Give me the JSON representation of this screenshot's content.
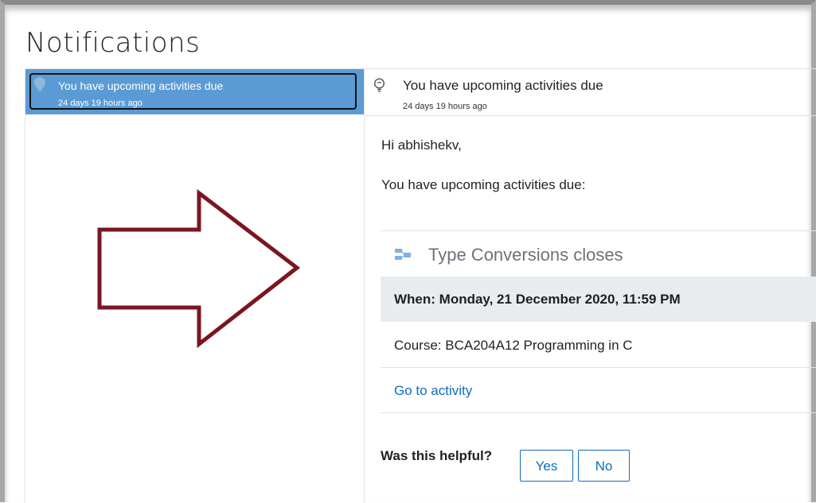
{
  "page": {
    "title": "Notifications"
  },
  "notification_list": {
    "items": [
      {
        "title": "You have upcoming activities due",
        "time": "24 days 19 hours ago",
        "selected": true
      }
    ]
  },
  "notification_detail": {
    "title": "You have upcoming activities due",
    "time": "24 days 19 hours ago",
    "greeting": "Hi abhishekv,",
    "intro": "You have upcoming activities due:",
    "event": {
      "name": "Type Conversions closes",
      "when": "When: Monday, 21 December 2020, 11:59 PM",
      "course": "Course: BCA204A12 Programming in C",
      "link_label": "Go to activity"
    },
    "feedback": {
      "question": "Was this helpful?",
      "yes_label": "Yes",
      "no_label": "No"
    }
  },
  "colors": {
    "selected_background": "#5b9bd5",
    "link": "#0f6cbf",
    "annotation_arrow": "#7b1522",
    "event_when_background": "#e9ecef"
  },
  "icons": {
    "notification": "lightbulb-icon",
    "event": "assignment-icon",
    "annotation": "right-arrow-annotation"
  }
}
